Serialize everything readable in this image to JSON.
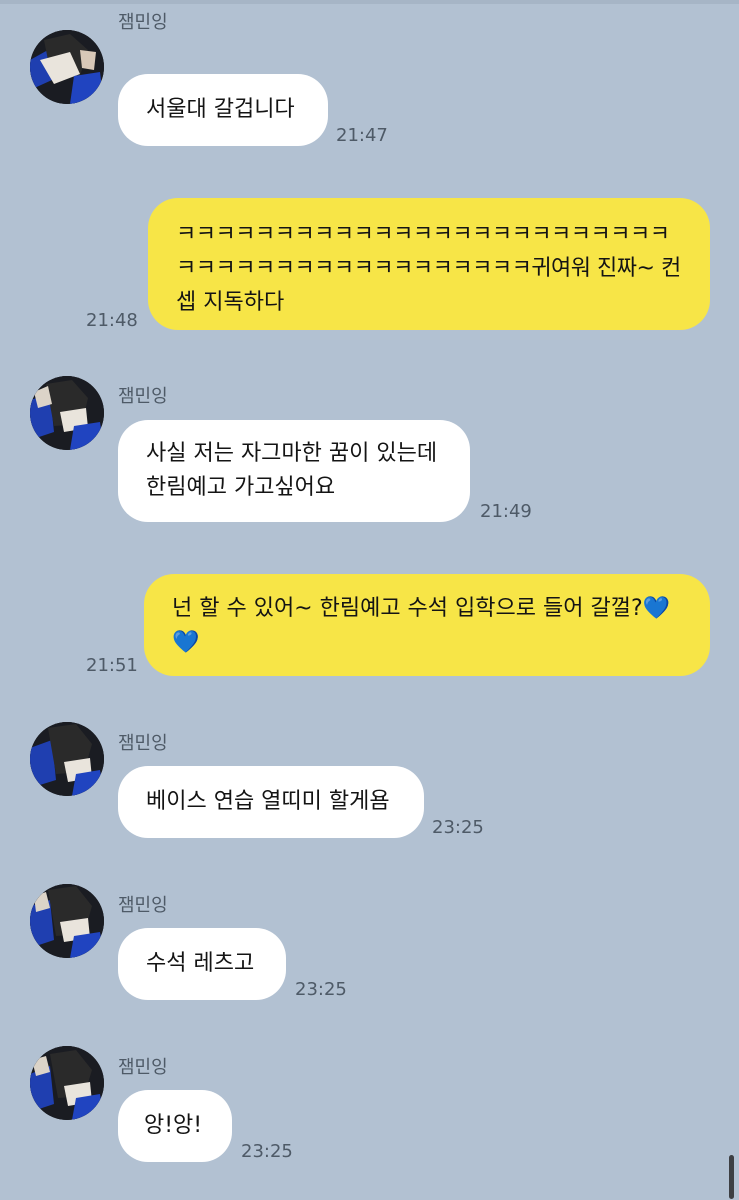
{
  "chat": {
    "sender_name": "잼민잉",
    "messages": [
      {
        "text": "서울대 갈겁니다",
        "time": "21:47"
      },
      {
        "line1": "ㅋㅋㅋㅋㅋㅋㅋㅋㅋㅋㅋㅋㅋㅋㅋㅋㅋㅋㅋㅋㅋㅋㅋㅋㅋ",
        "line2": "ㅋㅋㅋㅋㅋㅋㅋㅋㅋㅋㅋㅋㅋㅋㅋㅋㅋㅋ귀여워 진짜~ 컨",
        "line3": "셉 지독하다",
        "time": "21:48"
      },
      {
        "line1": "사실 저는 자그마한 꿈이 있는데",
        "line2": "한림예고 가고싶어요",
        "time": "21:49"
      },
      {
        "line1": "넌 할 수 있어~ 한림예고 수석 입학으로 들어 갈껄?",
        "heart": "💙",
        "time": "21:51"
      },
      {
        "text": "베이스 연습 열띠미 할게욤",
        "time": "23:25"
      },
      {
        "text": "수석 레츠고",
        "time": "23:25"
      },
      {
        "text": "앙!앙!",
        "time": "23:25"
      }
    ]
  },
  "colors": {
    "background": "#b2c1d2",
    "incoming_bubble": "#ffffff",
    "outgoing_bubble": "#f7e547",
    "heart": "#2e7ce8"
  },
  "icons": {
    "avatar": "profile-photo"
  }
}
